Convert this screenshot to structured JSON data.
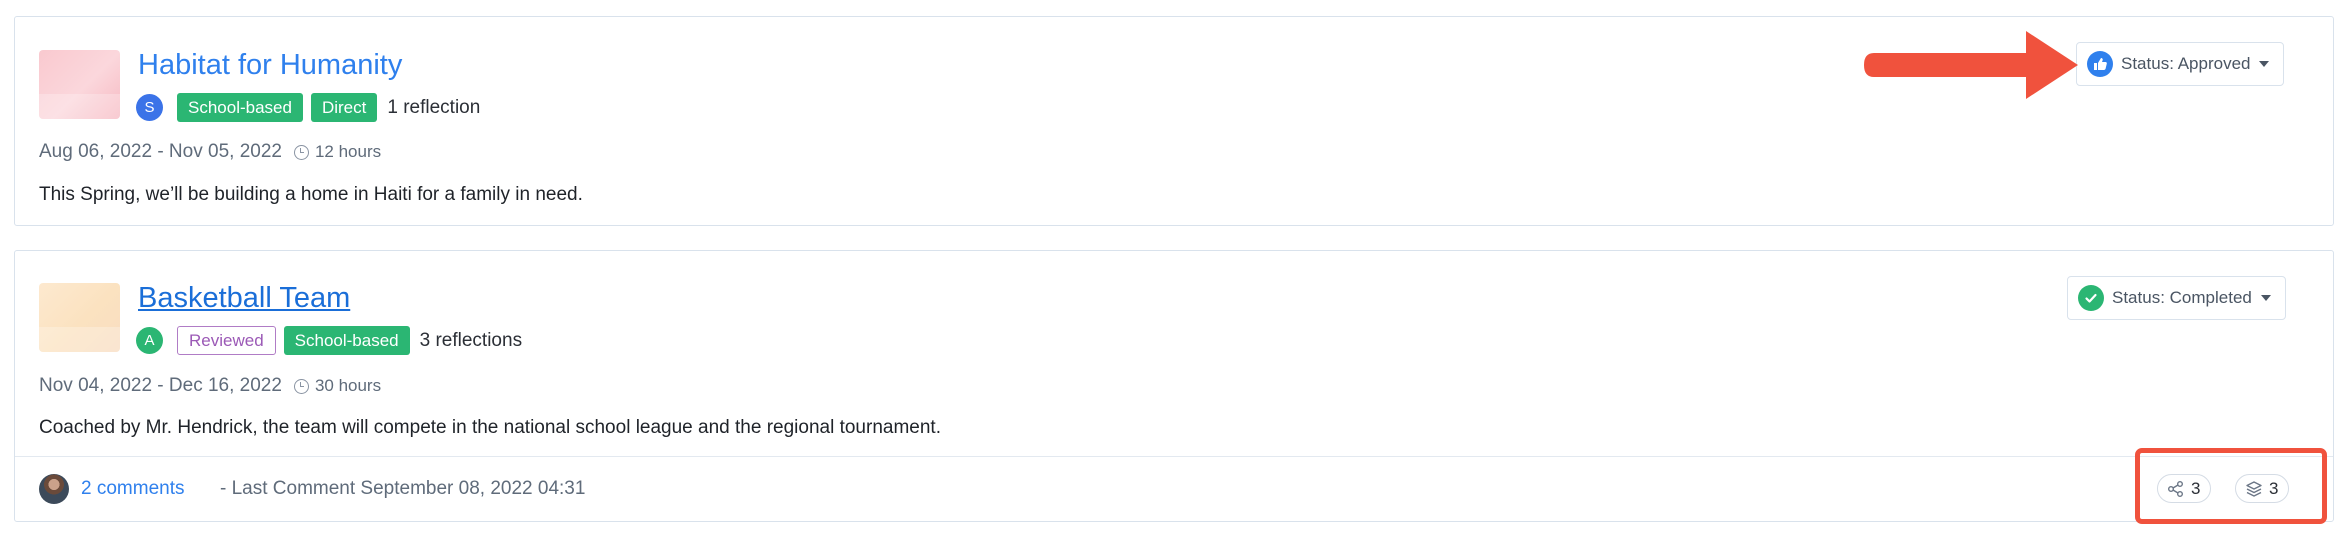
{
  "cards": [
    {
      "title": "Habitat for Humanity",
      "avatar_letter": "S",
      "avatar_color": "#3b73e8",
      "badges": [
        "School-based",
        "Direct"
      ],
      "reflections": "1 reflection",
      "dates": "Aug 06, 2022 - Nov 05, 2022",
      "hours": "12 hours",
      "description": "This Spring, we’ll be building a home in Haiti for a family in need.",
      "status": "Status: Approved",
      "status_icon": "thumbs-up-icon",
      "status_color": "#2f80ed"
    },
    {
      "title": "Basketball Team",
      "avatar_letter": "A",
      "avatar_color": "#2bb673",
      "badges": [
        "Reviewed",
        "School-based"
      ],
      "reflections": "3 reflections",
      "dates": "Nov 04, 2022 - Dec 16, 2022",
      "hours": "30 hours",
      "description": "Coached by Mr. Hendrick, the team will compete in the national school league and the regional tournament.",
      "status": "Status: Completed",
      "status_icon": "check-circle-icon",
      "status_color": "#2bb673",
      "footer": {
        "comments_link": "2 comments",
        "last_comment": "- Last Comment September 08, 2022 04:31",
        "share_count": "3",
        "layers_count": "3"
      }
    }
  ],
  "annotation_color": "#f0523d"
}
